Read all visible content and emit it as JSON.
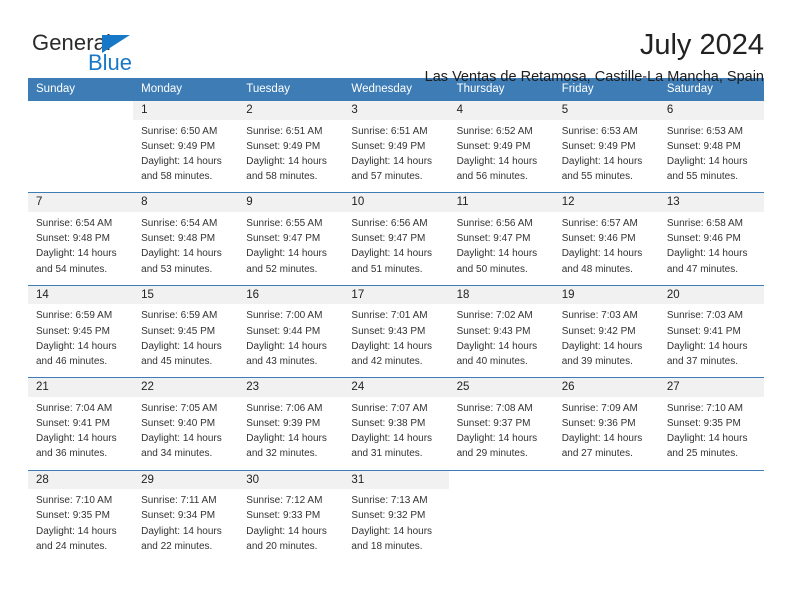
{
  "brand": {
    "name_part1": "General",
    "name_part2": "Blue",
    "accent_color": "#1878c8"
  },
  "header": {
    "title": "July 2024",
    "location": "Las Ventas de Retamosa, Castille-La Mancha, Spain"
  },
  "calendar": {
    "header_color": "#3d7cb5",
    "daynum_bg": "#f1f1f1",
    "weekdays": [
      "Sunday",
      "Monday",
      "Tuesday",
      "Wednesday",
      "Thursday",
      "Friday",
      "Saturday"
    ],
    "weeks": [
      [
        {
          "day": "",
          "lines": [
            "",
            "",
            "",
            ""
          ]
        },
        {
          "day": "1",
          "lines": [
            "Sunrise: 6:50 AM",
            "Sunset: 9:49 PM",
            "Daylight: 14 hours",
            "and 58 minutes."
          ]
        },
        {
          "day": "2",
          "lines": [
            "Sunrise: 6:51 AM",
            "Sunset: 9:49 PM",
            "Daylight: 14 hours",
            "and 58 minutes."
          ]
        },
        {
          "day": "3",
          "lines": [
            "Sunrise: 6:51 AM",
            "Sunset: 9:49 PM",
            "Daylight: 14 hours",
            "and 57 minutes."
          ]
        },
        {
          "day": "4",
          "lines": [
            "Sunrise: 6:52 AM",
            "Sunset: 9:49 PM",
            "Daylight: 14 hours",
            "and 56 minutes."
          ]
        },
        {
          "day": "5",
          "lines": [
            "Sunrise: 6:53 AM",
            "Sunset: 9:49 PM",
            "Daylight: 14 hours",
            "and 55 minutes."
          ]
        },
        {
          "day": "6",
          "lines": [
            "Sunrise: 6:53 AM",
            "Sunset: 9:48 PM",
            "Daylight: 14 hours",
            "and 55 minutes."
          ]
        }
      ],
      [
        {
          "day": "7",
          "lines": [
            "Sunrise: 6:54 AM",
            "Sunset: 9:48 PM",
            "Daylight: 14 hours",
            "and 54 minutes."
          ]
        },
        {
          "day": "8",
          "lines": [
            "Sunrise: 6:54 AM",
            "Sunset: 9:48 PM",
            "Daylight: 14 hours",
            "and 53 minutes."
          ]
        },
        {
          "day": "9",
          "lines": [
            "Sunrise: 6:55 AM",
            "Sunset: 9:47 PM",
            "Daylight: 14 hours",
            "and 52 minutes."
          ]
        },
        {
          "day": "10",
          "lines": [
            "Sunrise: 6:56 AM",
            "Sunset: 9:47 PM",
            "Daylight: 14 hours",
            "and 51 minutes."
          ]
        },
        {
          "day": "11",
          "lines": [
            "Sunrise: 6:56 AM",
            "Sunset: 9:47 PM",
            "Daylight: 14 hours",
            "and 50 minutes."
          ]
        },
        {
          "day": "12",
          "lines": [
            "Sunrise: 6:57 AM",
            "Sunset: 9:46 PM",
            "Daylight: 14 hours",
            "and 48 minutes."
          ]
        },
        {
          "day": "13",
          "lines": [
            "Sunrise: 6:58 AM",
            "Sunset: 9:46 PM",
            "Daylight: 14 hours",
            "and 47 minutes."
          ]
        }
      ],
      [
        {
          "day": "14",
          "lines": [
            "Sunrise: 6:59 AM",
            "Sunset: 9:45 PM",
            "Daylight: 14 hours",
            "and 46 minutes."
          ]
        },
        {
          "day": "15",
          "lines": [
            "Sunrise: 6:59 AM",
            "Sunset: 9:45 PM",
            "Daylight: 14 hours",
            "and 45 minutes."
          ]
        },
        {
          "day": "16",
          "lines": [
            "Sunrise: 7:00 AM",
            "Sunset: 9:44 PM",
            "Daylight: 14 hours",
            "and 43 minutes."
          ]
        },
        {
          "day": "17",
          "lines": [
            "Sunrise: 7:01 AM",
            "Sunset: 9:43 PM",
            "Daylight: 14 hours",
            "and 42 minutes."
          ]
        },
        {
          "day": "18",
          "lines": [
            "Sunrise: 7:02 AM",
            "Sunset: 9:43 PM",
            "Daylight: 14 hours",
            "and 40 minutes."
          ]
        },
        {
          "day": "19",
          "lines": [
            "Sunrise: 7:03 AM",
            "Sunset: 9:42 PM",
            "Daylight: 14 hours",
            "and 39 minutes."
          ]
        },
        {
          "day": "20",
          "lines": [
            "Sunrise: 7:03 AM",
            "Sunset: 9:41 PM",
            "Daylight: 14 hours",
            "and 37 minutes."
          ]
        }
      ],
      [
        {
          "day": "21",
          "lines": [
            "Sunrise: 7:04 AM",
            "Sunset: 9:41 PM",
            "Daylight: 14 hours",
            "and 36 minutes."
          ]
        },
        {
          "day": "22",
          "lines": [
            "Sunrise: 7:05 AM",
            "Sunset: 9:40 PM",
            "Daylight: 14 hours",
            "and 34 minutes."
          ]
        },
        {
          "day": "23",
          "lines": [
            "Sunrise: 7:06 AM",
            "Sunset: 9:39 PM",
            "Daylight: 14 hours",
            "and 32 minutes."
          ]
        },
        {
          "day": "24",
          "lines": [
            "Sunrise: 7:07 AM",
            "Sunset: 9:38 PM",
            "Daylight: 14 hours",
            "and 31 minutes."
          ]
        },
        {
          "day": "25",
          "lines": [
            "Sunrise: 7:08 AM",
            "Sunset: 9:37 PM",
            "Daylight: 14 hours",
            "and 29 minutes."
          ]
        },
        {
          "day": "26",
          "lines": [
            "Sunrise: 7:09 AM",
            "Sunset: 9:36 PM",
            "Daylight: 14 hours",
            "and 27 minutes."
          ]
        },
        {
          "day": "27",
          "lines": [
            "Sunrise: 7:10 AM",
            "Sunset: 9:35 PM",
            "Daylight: 14 hours",
            "and 25 minutes."
          ]
        }
      ],
      [
        {
          "day": "28",
          "lines": [
            "Sunrise: 7:10 AM",
            "Sunset: 9:35 PM",
            "Daylight: 14 hours",
            "and 24 minutes."
          ]
        },
        {
          "day": "29",
          "lines": [
            "Sunrise: 7:11 AM",
            "Sunset: 9:34 PM",
            "Daylight: 14 hours",
            "and 22 minutes."
          ]
        },
        {
          "day": "30",
          "lines": [
            "Sunrise: 7:12 AM",
            "Sunset: 9:33 PM",
            "Daylight: 14 hours",
            "and 20 minutes."
          ]
        },
        {
          "day": "31",
          "lines": [
            "Sunrise: 7:13 AM",
            "Sunset: 9:32 PM",
            "Daylight: 14 hours",
            "and 18 minutes."
          ]
        },
        {
          "day": "",
          "lines": [
            "",
            "",
            "",
            ""
          ]
        },
        {
          "day": "",
          "lines": [
            "",
            "",
            "",
            ""
          ]
        },
        {
          "day": "",
          "lines": [
            "",
            "",
            "",
            ""
          ]
        }
      ]
    ]
  }
}
